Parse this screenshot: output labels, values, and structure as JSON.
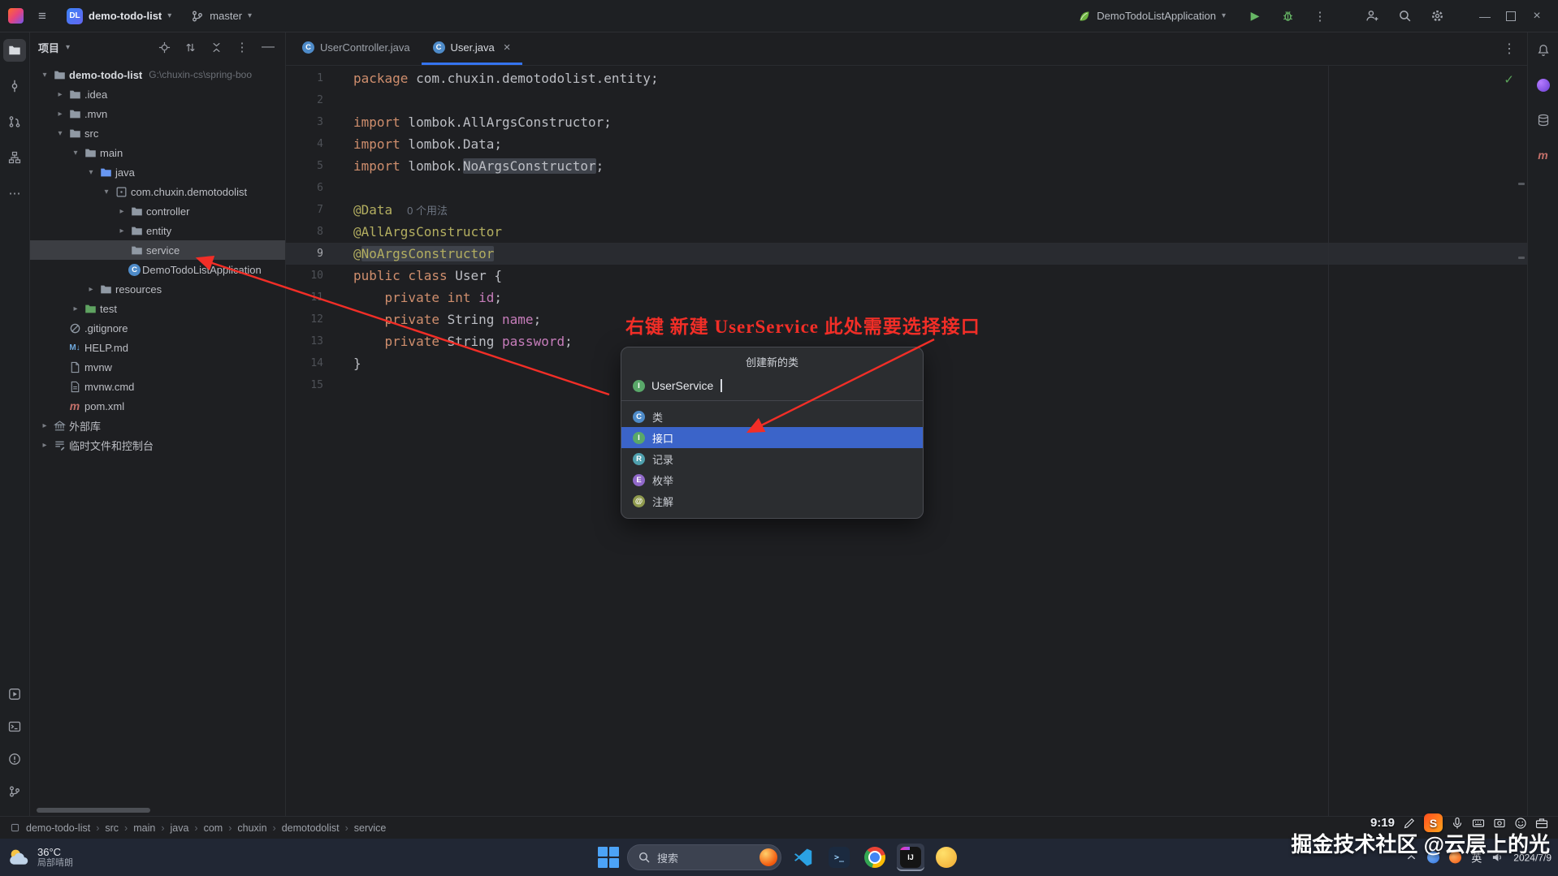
{
  "title_bar": {
    "project_badge": "DL",
    "project_name": "demo-todo-list",
    "branch_name": "master",
    "run_config": "DemoTodoListApplication",
    "right_icons": [
      "run",
      "debug",
      "more-vertical",
      "add-user",
      "search",
      "settings"
    ],
    "window_controls": [
      "minimize",
      "maximize",
      "close"
    ]
  },
  "left_strip": {
    "active": "project",
    "top": [
      "project",
      "commit",
      "pull-requests",
      "structure",
      "more"
    ],
    "bottom": [
      "run-services",
      "terminal",
      "problems",
      "version-control"
    ]
  },
  "right_strip": [
    "notifications",
    "ai-assistant",
    "database",
    "maven"
  ],
  "project_panel": {
    "title": "项目",
    "header_icons": [
      "locate",
      "scroll-from-source",
      "collapse-all",
      "more-vertical",
      "hide"
    ],
    "tree": [
      {
        "label": "demo-todo-list",
        "hint": "G:\\chuxin-cs\\spring-boo",
        "level": 0,
        "icon": "folder",
        "expanded": true,
        "bold": true
      },
      {
        "label": ".idea",
        "level": 1,
        "icon": "folder",
        "expanded": false
      },
      {
        "label": ".mvn",
        "level": 1,
        "icon": "folder",
        "expanded": false
      },
      {
        "label": "src",
        "level": 1,
        "icon": "folder",
        "expanded": true
      },
      {
        "label": "main",
        "level": 2,
        "icon": "folder",
        "expanded": true
      },
      {
        "label": "java",
        "level": 3,
        "icon": "folder-src",
        "expanded": true
      },
      {
        "label": "com.chuxin.demotodolist",
        "level": 4,
        "icon": "package",
        "expanded": true
      },
      {
        "label": "controller",
        "level": 5,
        "icon": "folder",
        "expanded": false
      },
      {
        "label": "entity",
        "level": 5,
        "icon": "folder",
        "expanded": false
      },
      {
        "label": "service",
        "level": 5,
        "icon": "folder",
        "selected": true
      },
      {
        "label": "DemoTodoListApplication",
        "level": 5,
        "icon": "java-class"
      },
      {
        "label": "resources",
        "level": 3,
        "icon": "folder",
        "expanded": false
      },
      {
        "label": "test",
        "level": 2,
        "icon": "folder-test",
        "expanded": false
      },
      {
        "label": ".gitignore",
        "level": 1,
        "icon": "ignore"
      },
      {
        "label": "HELP.md",
        "level": 1,
        "icon": "markdown"
      },
      {
        "label": "mvnw",
        "level": 1,
        "icon": "file"
      },
      {
        "label": "mvnw.cmd",
        "level": 1,
        "icon": "file-cmd"
      },
      {
        "label": "pom.xml",
        "level": 1,
        "icon": "maven"
      },
      {
        "label": "外部库",
        "level": 0,
        "icon": "libraries",
        "expanded": false
      },
      {
        "label": "临时文件和控制台",
        "level": 0,
        "icon": "scratches",
        "expanded": false
      }
    ]
  },
  "editor": {
    "tabs": [
      {
        "label": "UserController.java",
        "icon": "java-class",
        "active": false
      },
      {
        "label": "User.java",
        "icon": "java-class",
        "active": true,
        "closable": true
      }
    ],
    "lines": [
      {
        "num": 1,
        "segments": [
          {
            "t": "package",
            "c": "kw"
          },
          {
            "t": " com.chuxin.demotodolist.entity;",
            "c": "plain"
          }
        ]
      },
      {
        "num": 2,
        "segments": []
      },
      {
        "num": 3,
        "segments": [
          {
            "t": "import",
            "c": "kw"
          },
          {
            "t": " lombok.AllArgsConstructor;",
            "c": "plain"
          }
        ]
      },
      {
        "num": 4,
        "segments": [
          {
            "t": "import",
            "c": "kw"
          },
          {
            "t": " lombok.Data;",
            "c": "plain"
          }
        ]
      },
      {
        "num": 5,
        "segments": [
          {
            "t": "import",
            "c": "kw"
          },
          {
            "t": " lombok.",
            "c": "plain"
          },
          {
            "t": "NoArgsConstructor",
            "c": "plain hl"
          },
          {
            "t": ";",
            "c": "plain"
          }
        ]
      },
      {
        "num": 6,
        "segments": []
      },
      {
        "num": 7,
        "segments": [
          {
            "t": "@Data",
            "c": "ann"
          },
          {
            "t": "0 个用法",
            "c": "hint"
          }
        ]
      },
      {
        "num": 8,
        "segments": [
          {
            "t": "@AllArgsConstructor",
            "c": "ann"
          }
        ]
      },
      {
        "num": 9,
        "current": true,
        "segments": [
          {
            "t": "@",
            "c": "ann"
          },
          {
            "t": "NoArgsConstructor",
            "c": "ann hl"
          }
        ]
      },
      {
        "num": 10,
        "segments": [
          {
            "t": "public class",
            "c": "kw"
          },
          {
            "t": " User {",
            "c": "plain"
          }
        ]
      },
      {
        "num": 11,
        "segments": [
          {
            "t": "    ",
            "c": "plain"
          },
          {
            "t": "private int",
            "c": "kw"
          },
          {
            "t": " ",
            "c": "plain"
          },
          {
            "t": "id",
            "c": "field"
          },
          {
            "t": ";",
            "c": "plain"
          }
        ]
      },
      {
        "num": 12,
        "segments": [
          {
            "t": "    ",
            "c": "plain"
          },
          {
            "t": "private",
            "c": "kw"
          },
          {
            "t": " String ",
            "c": "plain"
          },
          {
            "t": "name",
            "c": "field"
          },
          {
            "t": ";",
            "c": "plain"
          }
        ]
      },
      {
        "num": 13,
        "segments": [
          {
            "t": "    ",
            "c": "plain"
          },
          {
            "t": "private",
            "c": "kw"
          },
          {
            "t": " String ",
            "c": "plain"
          },
          {
            "t": "password",
            "c": "field"
          },
          {
            "t": ";",
            "c": "plain"
          }
        ]
      },
      {
        "num": 14,
        "segments": [
          {
            "t": "}",
            "c": "plain"
          }
        ]
      },
      {
        "num": 15,
        "segments": []
      }
    ]
  },
  "popup": {
    "title": "创建新的类",
    "input_value": "UserService",
    "options": [
      {
        "label": "类",
        "icon": "class"
      },
      {
        "label": "接口",
        "icon": "interface",
        "selected": true
      },
      {
        "label": "记录",
        "icon": "record"
      },
      {
        "label": "枚举",
        "icon": "enum"
      },
      {
        "label": "注解",
        "icon": "annotation"
      }
    ]
  },
  "annotation": {
    "text": "右键 新建 UserService 此处需要选择接口"
  },
  "breadcrumb": [
    "demo-todo-list",
    "src",
    "main",
    "java",
    "com",
    "chuxin",
    "demotodolist",
    "service"
  ],
  "taskbar": {
    "weather_temp": "36°C",
    "weather_desc": "局部晴朗",
    "search_label": "搜索",
    "apps": [
      "vscode",
      "windows-terminal",
      "chrome",
      "intellij-idea",
      "yellow-app"
    ],
    "tray_icons": [
      "tray-expand",
      "tray-blue-app",
      "tray-orange-app"
    ],
    "ime": "英",
    "date": "2024/7/9"
  },
  "ime_bar": {
    "time": "9:19",
    "icons": [
      "pencil",
      "sogou-logo",
      "mic",
      "keyboard",
      "screenshot",
      "emoji",
      "toolbox"
    ]
  },
  "watermark": "掘金技术社区 @云层上的光",
  "colors": {
    "accent": "#3574F0",
    "selection": "#3B64C9",
    "annotation_red": "#F22E27"
  }
}
